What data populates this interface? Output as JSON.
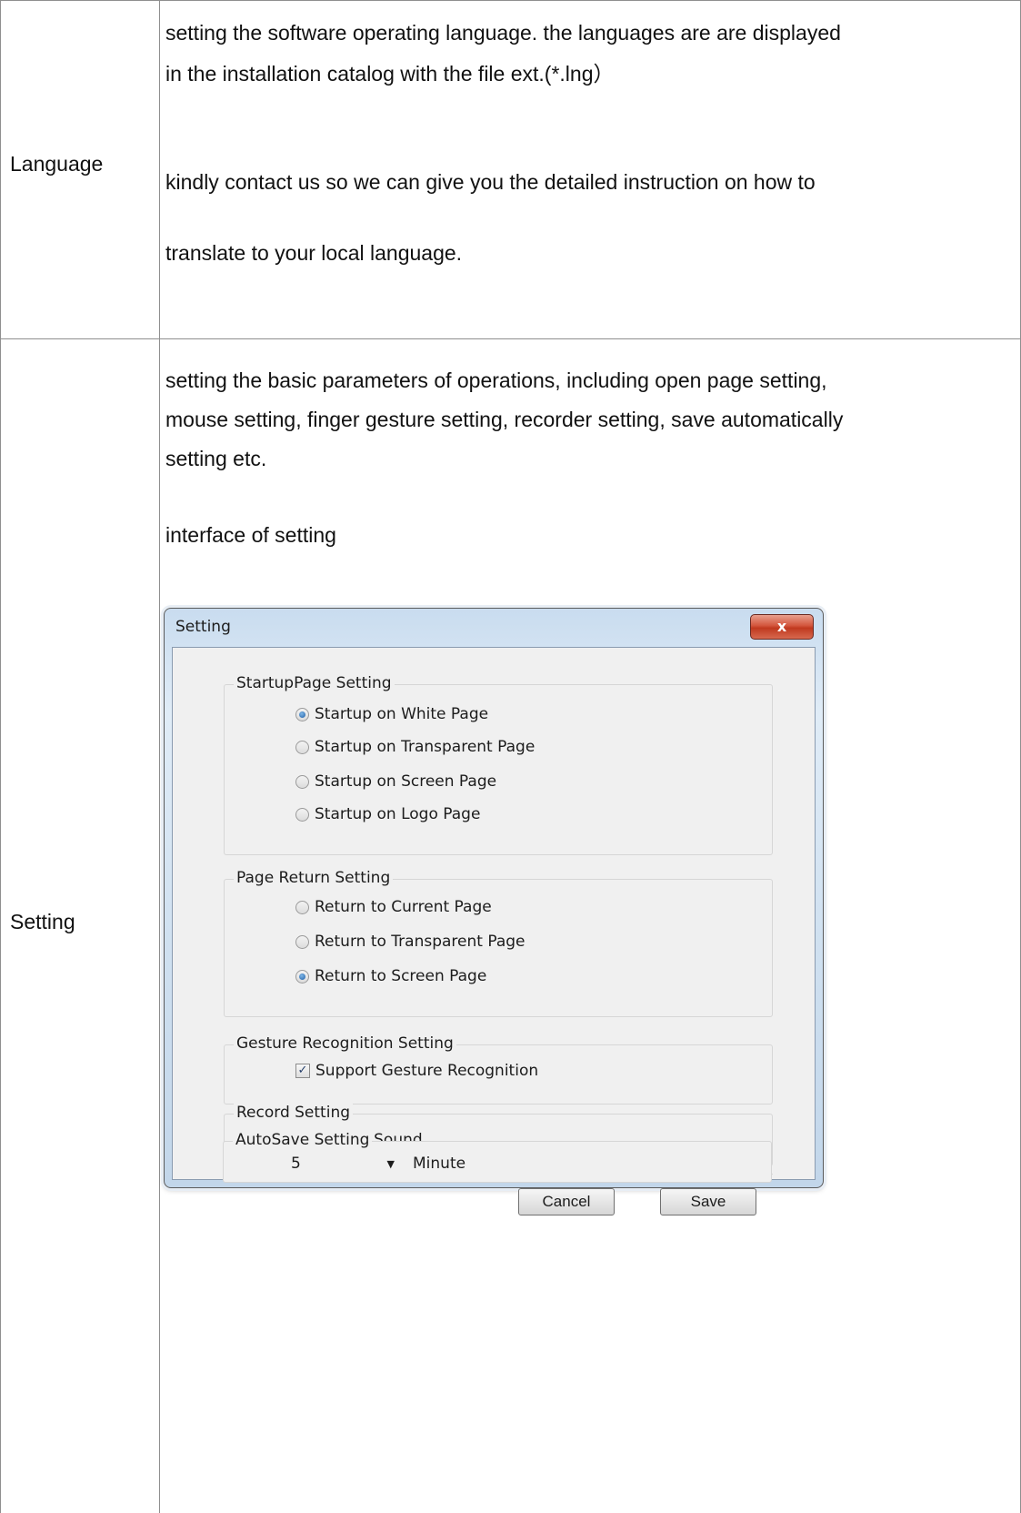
{
  "rows": [
    {
      "label": "Language",
      "lines": [
        "setting the software operating language. the languages are are displayed",
        "in the installation catalog with the file ext.(*.lng）",
        "kindly contact us so we can give you the detailed instruction on how to",
        "translate to your local language."
      ]
    },
    {
      "label": "Setting",
      "lines": [
        "setting the basic parameters of operations, including open page setting,",
        "mouse setting, finger gesture setting, recorder setting, save automatically",
        "setting etc.",
        "interface of setting"
      ]
    }
  ],
  "dialog": {
    "title": "Setting",
    "close_label": "x",
    "startup": {
      "title": "StartupPage Setting",
      "options": [
        {
          "label": "Startup on White Page",
          "selected": true
        },
        {
          "label": "Startup on Transparent Page",
          "selected": false
        },
        {
          "label": "Startup on Screen Page",
          "selected": false
        },
        {
          "label": "Startup on Logo Page",
          "selected": false
        }
      ]
    },
    "return": {
      "title": "Page Return Setting",
      "options": [
        {
          "label": "Return to Current Page",
          "selected": false
        },
        {
          "label": "Return to Transparent Page",
          "selected": false
        },
        {
          "label": "Return to Screen Page",
          "selected": true
        }
      ]
    },
    "gesture": {
      "title": "Gesture Recognition Setting",
      "checkbox_label": "Support Gesture Recognition",
      "checked": true
    },
    "record": {
      "title": "Record Setting",
      "checkbox_label": "Record Sound",
      "checked": false
    },
    "autosave": {
      "title": "AutoSave Setting",
      "value": "5",
      "unit": "Minute"
    },
    "cancel_label": "Cancel",
    "save_label": "Save"
  }
}
